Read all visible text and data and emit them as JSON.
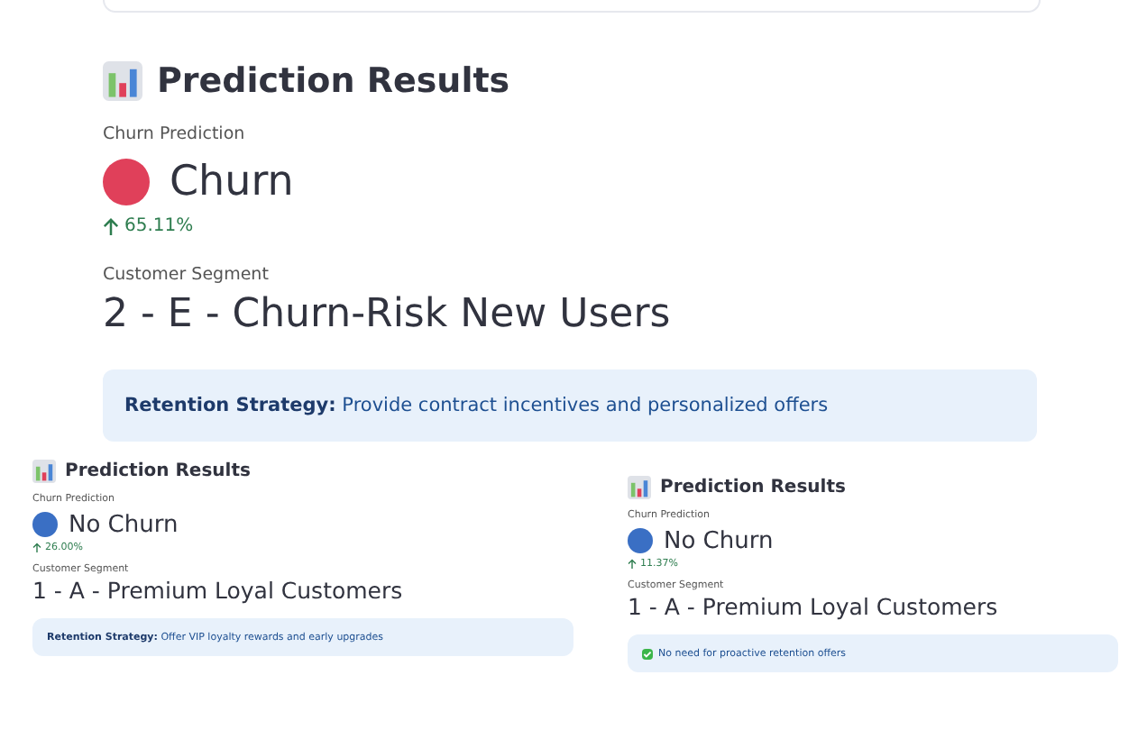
{
  "panels": [
    {
      "kind": "large",
      "title": "Prediction Results",
      "prediction_label": "Churn Prediction",
      "prediction": "Churn",
      "color": "#e0405a",
      "delta": "65.11%",
      "segment_label": "Customer Segment",
      "segment": "2 - E - Churn-Risk New Users",
      "strategy": {
        "kind": "info",
        "text": "**Retention Strategy:** Provide contract incentives and personalized offers"
      }
    },
    {
      "kind": "small",
      "title": "Prediction Results",
      "prediction_label": "Churn Prediction",
      "prediction": "No Churn",
      "color": "#3a6fc4",
      "delta": "26.00%",
      "segment_label": "Customer Segment",
      "segment": "1 - A - Premium Loyal Customers",
      "strategy": {
        "kind": "info",
        "text": "**Retention Strategy:** Offer VIP loyalty rewards and early upgrades"
      }
    },
    {
      "kind": "small",
      "title": "Prediction Results",
      "prediction_label": "Churn Prediction",
      "prediction": "No Churn",
      "color": "#3a6fc4",
      "delta": "11.37%",
      "segment_label": "Customer Segment",
      "segment": "1 - A - Premium Loyal Customers",
      "strategy": {
        "kind": "check",
        "text": "No need for proactive retention offers"
      }
    }
  ]
}
